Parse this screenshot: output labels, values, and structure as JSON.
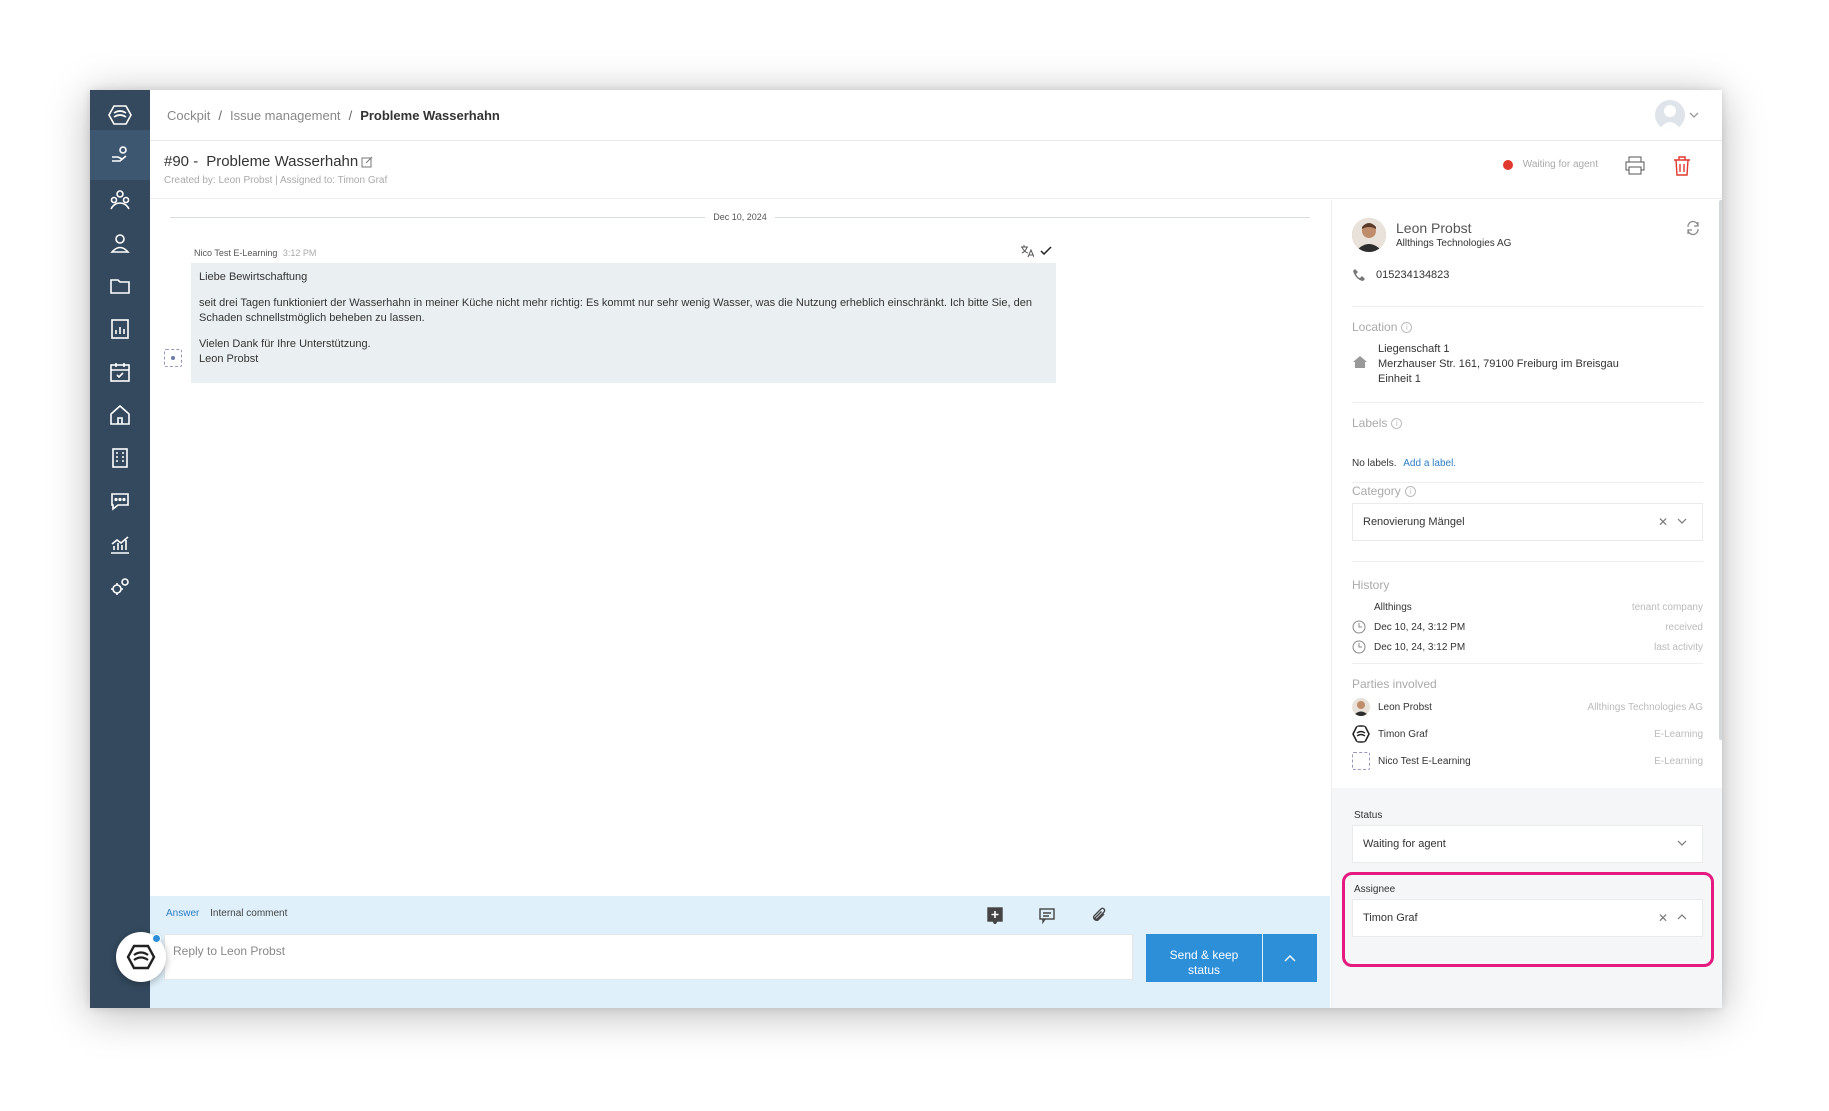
{
  "breadcrumb": {
    "items": [
      "Cockpit",
      "Issue management"
    ],
    "separator": "/",
    "current": "Probleme Wasserhahn"
  },
  "issue": {
    "number": "#90 -",
    "title": "Probleme Wasserhahn",
    "created_by": "Created by: Leon Probst | Assigned to: Timon Graf",
    "status": "Waiting for agent",
    "status_color": "#e0392d"
  },
  "conversation": {
    "date": "Dec 10, 2024",
    "message": {
      "author": "Nico Test E-Learning",
      "time": "3:12 PM",
      "greeting": "Liebe Bewirtschaftung",
      "body": "seit drei Tagen funktioniert der Wasserhahn in meiner Küche nicht mehr richtig: Es kommt nur sehr wenig Wasser, was die Nutzung erheblich einschränkt. Ich bitte Sie, den Schaden schnellstmöglich beheben zu lassen.",
      "closing": "Vielen Dank für Ihre Unterstützung.",
      "signature": "Leon Probst"
    }
  },
  "reply": {
    "tab_answer": "Answer",
    "tab_internal": "Internal comment",
    "placeholder": "Reply to Leon Probst",
    "send_line1": "Send & keep",
    "send_line2": "status"
  },
  "contact": {
    "name": "Leon Probst",
    "company": "Allthings Technologies AG",
    "phone": "015234134823"
  },
  "location": {
    "label": "Location",
    "line1": "Liegenschaft 1",
    "line2": "Merzhauser Str. 161, 79100 Freiburg im Breisgau",
    "line3": "Einheit 1"
  },
  "labels": {
    "label": "Labels",
    "empty": "No labels.",
    "add": "Add a label."
  },
  "category": {
    "label": "Category",
    "value": "Renovierung Mängel"
  },
  "history": {
    "label": "History",
    "rows": [
      {
        "text": "Allthings",
        "tag": "tenant company"
      },
      {
        "text": "Dec 10, 24, 3:12 PM",
        "tag": "received"
      },
      {
        "text": "Dec 10, 24, 3:12 PM",
        "tag": "last activity"
      }
    ]
  },
  "parties": {
    "label": "Parties involved",
    "rows": [
      {
        "name": "Leon Probst",
        "org": "Allthings Technologies AG"
      },
      {
        "name": "Timon Graf",
        "org": "E-Learning"
      },
      {
        "name": "Nico Test E-Learning",
        "org": "E-Learning"
      }
    ]
  },
  "status_field": {
    "label": "Status",
    "value": "Waiting for agent"
  },
  "assignee_field": {
    "label": "Assignee",
    "value": "Timon Graf"
  },
  "colors": {
    "sidebar": "#34495e",
    "accent": "#2e8fd9",
    "highlight": "#e5197f"
  }
}
